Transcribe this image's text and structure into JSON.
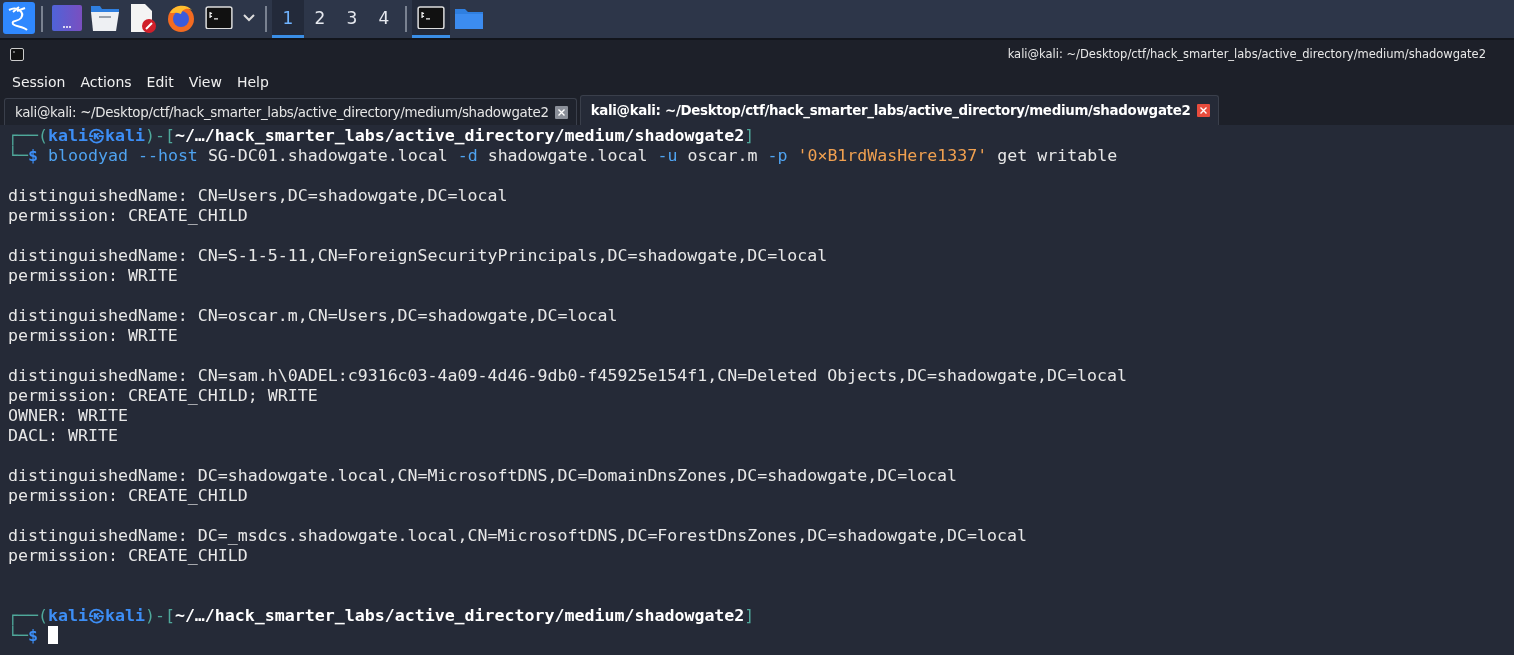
{
  "taskbar": {
    "workspaces": [
      {
        "label": "1",
        "selected": true
      },
      {
        "label": "2",
        "selected": false
      },
      {
        "label": "3",
        "selected": false
      },
      {
        "label": "4",
        "selected": false
      }
    ]
  },
  "window": {
    "title": "kali@kali: ~/Desktop/ctf/hack_smarter_labs/active_directory/medium/shadowgate2"
  },
  "menu": [
    "Session",
    "Actions",
    "Edit",
    "View",
    "Help"
  ],
  "tabs": [
    {
      "label": "kali@kali: ~/Desktop/ctf/hack_smarter_labs/active_directory/medium/shadowgate2",
      "selected": false
    },
    {
      "label": "kali@kali: ~/Desktop/ctf/hack_smarter_labs/active_directory/medium/shadowgate2",
      "selected": true
    }
  ],
  "terminal": {
    "prompts": [
      {
        "open": "┌──(",
        "user": "kali",
        "at": "㉿",
        "host": "kali",
        "mid": ")-[",
        "path": "~/…/hack_smarter_labs/active_directory/medium/shadowgate2",
        "close": "]",
        "corner": "└─",
        "sign": "$"
      },
      {
        "open": "┌──(",
        "user": "kali",
        "at": "㉿",
        "host": "kali",
        "mid": ")-[",
        "path": "~/…/hack_smarter_labs/active_directory/medium/shadowgate2",
        "close": "]",
        "corner": "└─",
        "sign": "$"
      }
    ],
    "command": [
      {
        "kind": "cmd",
        "text": "bloodyad"
      },
      {
        "kind": "flag",
        "text": "--host"
      },
      {
        "kind": "arg",
        "text": "SG-DC01.shadowgate.local"
      },
      {
        "kind": "flag",
        "text": "-d"
      },
      {
        "kind": "arg",
        "text": "shadowgate.local"
      },
      {
        "kind": "flag",
        "text": "-u"
      },
      {
        "kind": "arg",
        "text": "oscar.m"
      },
      {
        "kind": "flag",
        "text": "-p"
      },
      {
        "kind": "string",
        "text": "'0×B1rdWasHere1337'"
      },
      {
        "kind": "arg",
        "text": "get"
      },
      {
        "kind": "arg",
        "text": "writable"
      }
    ],
    "blocks": [
      {
        "lines": [
          "distinguishedName: CN=Users,DC=shadowgate,DC=local",
          "permission: CREATE_CHILD"
        ]
      },
      {
        "lines": [
          "distinguishedName: CN=S-1-5-11,CN=ForeignSecurityPrincipals,DC=shadowgate,DC=local",
          "permission: WRITE"
        ]
      },
      {
        "lines": [
          "distinguishedName: CN=oscar.m,CN=Users,DC=shadowgate,DC=local",
          "permission: WRITE"
        ]
      },
      {
        "lines": [
          "distinguishedName: CN=sam.h\\0ADEL:c9316c03-4a09-4d46-9db0-f45925e154f1,CN=Deleted Objects,DC=shadowgate,DC=local",
          "permission: CREATE_CHILD; WRITE",
          "OWNER: WRITE",
          "DACL: WRITE"
        ]
      },
      {
        "lines": [
          "distinguishedName: DC=shadowgate.local,CN=MicrosoftDNS,DC=DomainDnsZones,DC=shadowgate,DC=local",
          "permission: CREATE_CHILD"
        ]
      },
      {
        "lines": [
          "distinguishedName: DC=_msdcs.shadowgate.local,CN=MicrosoftDNS,DC=ForestDnsZones,DC=shadowgate,DC=local",
          "permission: CREATE_CHILD"
        ]
      }
    ]
  }
}
